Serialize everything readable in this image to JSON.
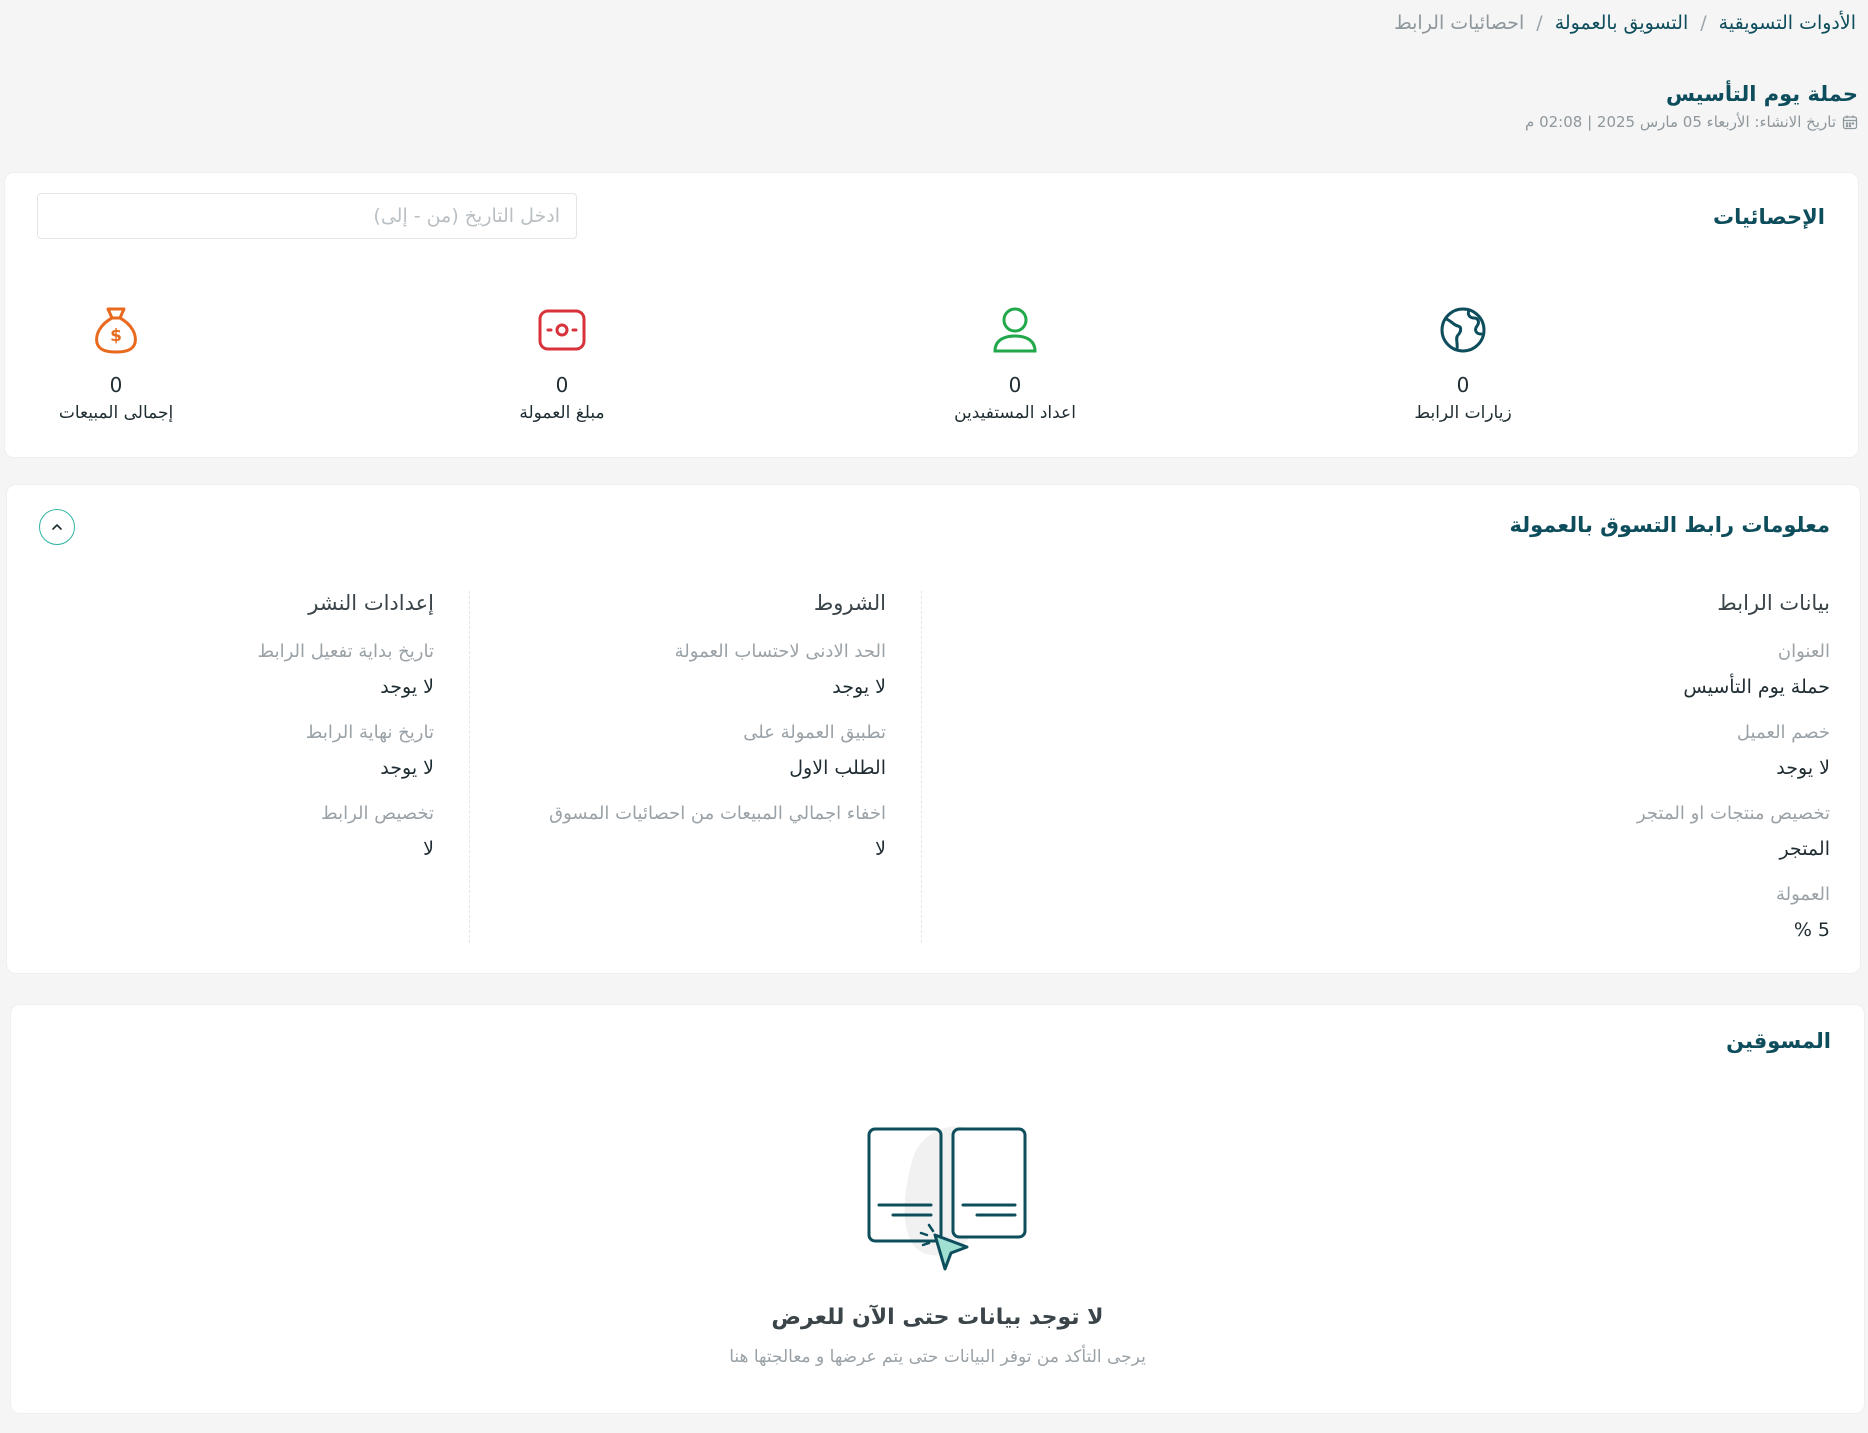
{
  "breadcrumb": {
    "item1": "الأدوات التسويقية",
    "item2": "التسويق بالعمولة",
    "current": "احصائيات الرابط",
    "separator": "/"
  },
  "header": {
    "title": "حملة يوم التأسيس",
    "created": "تاريخ الانشاء: الأربعاء 05 مارس 2025 | 02:08 م"
  },
  "stats": {
    "title": "الإحصائيات",
    "date_placeholder": "ادخل التاريخ (من - إلى)",
    "items": [
      {
        "label": "زيارات الرابط",
        "value": "0",
        "icon": "globe-icon",
        "color": "#0d4d5c"
      },
      {
        "label": "اعداد المستفيدين",
        "value": "0",
        "icon": "user-icon",
        "color": "#22a84a"
      },
      {
        "label": "مبلغ العمولة",
        "value": "0",
        "icon": "cash-icon",
        "color": "#d8323a"
      },
      {
        "label": "إجمالى المبيعات",
        "value": "0",
        "icon": "money-bag-icon",
        "color": "#e86a1e"
      }
    ]
  },
  "info": {
    "title": "معلومات رابط التسوق بالعمولة",
    "link_data": {
      "heading": "بيانات الرابط",
      "fields": [
        {
          "label": "العنوان",
          "value": "حملة يوم التأسيس"
        },
        {
          "label": "خصم العميل",
          "value": "لا يوجد"
        },
        {
          "label": "تخصيص منتجات او المتجر",
          "value": "المتجر"
        },
        {
          "label": "العمولة",
          "value": "5 %"
        }
      ]
    },
    "conditions": {
      "heading": "الشروط",
      "fields": [
        {
          "label": "الحد الادنى لاحتساب العمولة",
          "value": "لا يوجد"
        },
        {
          "label": "تطبيق العمولة على",
          "value": "الطلب الاول"
        },
        {
          "label": "اخفاء اجمالي المبيعات من احصائيات المسوق",
          "value": "لا"
        }
      ]
    },
    "publish": {
      "heading": "إعدادات النشر",
      "fields": [
        {
          "label": "تاريخ بداية تفعيل الرابط",
          "value": "لا يوجد"
        },
        {
          "label": "تاريخ نهاية الرابط",
          "value": "لا يوجد"
        },
        {
          "label": "تخصيص الرابط",
          "value": "لا"
        }
      ]
    }
  },
  "marketers": {
    "title": "المسوقين",
    "empty_title": "لا توجد بيانات حتى الآن للعرض",
    "empty_subtitle": "يرجى التأكد من توفر البيانات حتى يتم عرضها و معالجتها هنا"
  },
  "colors": {
    "primary": "#0d4d5c",
    "accent": "#2fb6a3"
  }
}
